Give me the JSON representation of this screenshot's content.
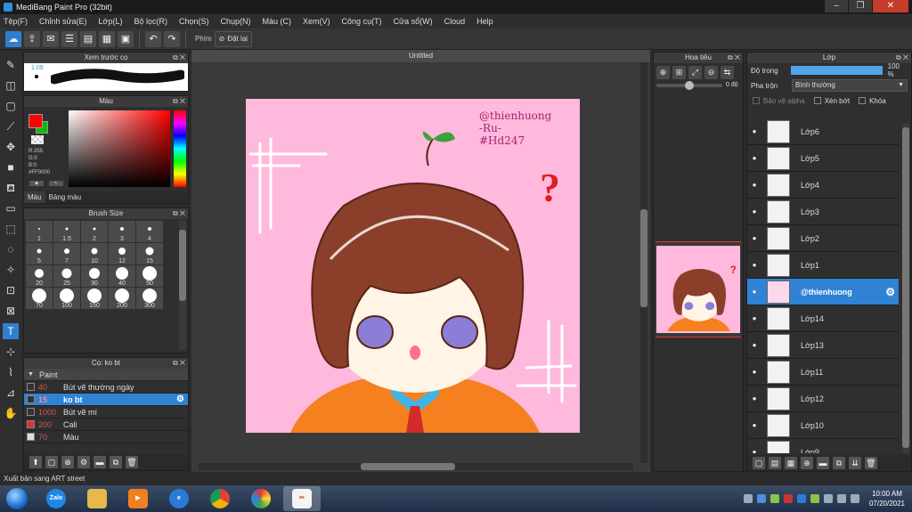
{
  "window": {
    "title": "MediBang Paint Pro (32bit)",
    "controls": [
      "–",
      "❐",
      "✕"
    ]
  },
  "menu": [
    "Tệp(F)",
    "Chỉnh sửa(E)",
    "Lớp(L)",
    "Bộ lọc(R)",
    "Chọn(S)",
    "Chụp(N)",
    "Màu (C)",
    "Xem(V)",
    "Công cụ(T)",
    "Cửa sổ(W)",
    "Cloud",
    "Help"
  ],
  "toolbar": {
    "shortcut_label": "Phím",
    "reset_label": "Đặt lại"
  },
  "brush_preview": {
    "title": "Xem trước cọ",
    "size_value": "1.09"
  },
  "color_panel": {
    "title": "Màu",
    "r": "R:255",
    "g": "G:0",
    "b": "B:0",
    "hex": "#FF0000",
    "primary_color": "#ff0000",
    "secondary_color": "#00c000",
    "tabs": [
      "Màu",
      "Bảng màu"
    ]
  },
  "brush_size": {
    "title": "Brush Size",
    "sizes": [
      "1",
      "1.5",
      "2",
      "3",
      "4",
      "5",
      "7",
      "10",
      "12",
      "15",
      "20",
      "25",
      "30",
      "40",
      "50",
      "70",
      "100",
      "150",
      "200",
      "300"
    ]
  },
  "brush_list": {
    "title": "Cọ: ko bt",
    "group": "Paint",
    "items": [
      {
        "size": "40",
        "name": "Bút vẽ thường ngày",
        "color": "#333333"
      },
      {
        "size": "15",
        "name": "ko bt",
        "color": "#333333",
        "selected": true
      },
      {
        "size": "1000",
        "name": "Bút vẽ mí",
        "color": "#333333"
      },
      {
        "size": "200",
        "name": "Cali",
        "color": "#e03030"
      },
      {
        "size": "70",
        "name": "Màu",
        "color": "#dddddd"
      }
    ]
  },
  "document": {
    "tab": "Untitled",
    "signature": [
      "@thienhuong",
      "-Ru-",
      "#Hd247"
    ]
  },
  "navigator": {
    "title": "Hoa tiêu",
    "angle": "0 độ"
  },
  "layers": {
    "title": "Lớp",
    "opacity_label": "Độ trong",
    "opacity_value": "100 %",
    "opacity_fraction": 1.0,
    "blend_label": "Pha trộn",
    "blend_value": "Bình thường",
    "protect_alpha": "Bảo vệ alpha",
    "clip": "Xén bớt",
    "lock": "Khóa",
    "items": [
      {
        "name": "Lớp6"
      },
      {
        "name": "Lớp5"
      },
      {
        "name": "Lớp4"
      },
      {
        "name": "Lớp3"
      },
      {
        "name": "Lớp2"
      },
      {
        "name": "Lớp1"
      },
      {
        "name": "@thienhuong",
        "selected": true
      },
      {
        "name": "Lớp14"
      },
      {
        "name": "Lớp13"
      },
      {
        "name": "Lớp11"
      },
      {
        "name": "Lớp12"
      },
      {
        "name": "Lớp10"
      },
      {
        "name": "Lớp9"
      }
    ]
  },
  "status": {
    "text": "Xuất bản sang ART street"
  },
  "taskbar": {
    "apps": [
      "Zalo"
    ],
    "time": "10:00 AM",
    "date": "07/20/2021"
  }
}
